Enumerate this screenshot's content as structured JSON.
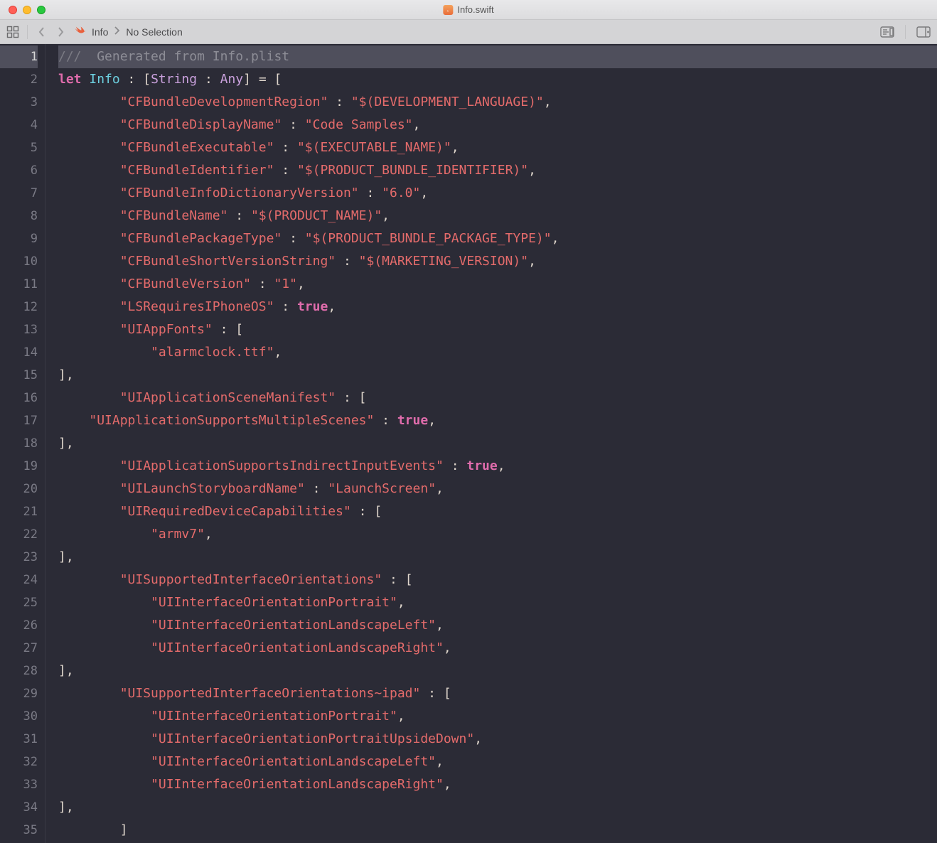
{
  "window": {
    "title": "Info.swift"
  },
  "jumpbar": {
    "file_crumb": "Info",
    "selection_crumb": "No Selection"
  },
  "editor": {
    "highlighted_line": 1,
    "lines_total": 35,
    "comment_slashes": "///",
    "comment_text": "Generated from Info.plist",
    "decl": {
      "let": "let",
      "name": "Info",
      "colon1": " : ",
      "lbracket_type": "[",
      "type_key": "String",
      "type_sep": " : ",
      "type_val": "Any",
      "rbracket_type": "]",
      "eq": " = ",
      "open": "["
    },
    "entries": [
      {
        "key": "\"CFBundleDevelopmentRegion\"",
        "sep": " : ",
        "val": "\"$(DEVELOPMENT_LANGUAGE)\"",
        "trail": ","
      },
      {
        "key": "\"CFBundleDisplayName\"",
        "sep": " : ",
        "val": "\"Code Samples\"",
        "trail": ","
      },
      {
        "key": "\"CFBundleExecutable\"",
        "sep": " : ",
        "val": "\"$(EXECUTABLE_NAME)\"",
        "trail": ","
      },
      {
        "key": "\"CFBundleIdentifier\"",
        "sep": " : ",
        "val": "\"$(PRODUCT_BUNDLE_IDENTIFIER)\"",
        "trail": ","
      },
      {
        "key": "\"CFBundleInfoDictionaryVersion\"",
        "sep": " : ",
        "val": "\"6.0\"",
        "trail": ","
      },
      {
        "key": "\"CFBundleName\"",
        "sep": " : ",
        "val": "\"$(PRODUCT_NAME)\"",
        "trail": ","
      },
      {
        "key": "\"CFBundlePackageType\"",
        "sep": " : ",
        "val": "\"$(PRODUCT_BUNDLE_PACKAGE_TYPE)\"",
        "trail": ","
      },
      {
        "key": "\"CFBundleShortVersionString\"",
        "sep": " : ",
        "val": "\"$(MARKETING_VERSION)\"",
        "trail": ","
      },
      {
        "key": "\"CFBundleVersion\"",
        "sep": " : ",
        "val": "\"1\"",
        "trail": ","
      }
    ],
    "ls_requires": {
      "key": "\"LSRequiresIPhoneOS\"",
      "sep": " : ",
      "bool": "true",
      "trail": ","
    },
    "uiappfonts": {
      "key": "\"UIAppFonts\"",
      "sep": " : ",
      "open": "[",
      "item": "\"alarmclock.ttf\"",
      "item_trail": ",",
      "close": "],"
    },
    "scene_manifest": {
      "key": "\"UIApplicationSceneManifest\"",
      "sep": " : ",
      "open": "["
    },
    "supports_multi": {
      "key": "\"UIApplicationSupportsMultipleScenes\"",
      "sep": " : ",
      "bool": "true",
      "trail": ",",
      "close": "],"
    },
    "supports_indirect": {
      "key": "\"UIApplicationSupportsIndirectInputEvents\"",
      "sep": " : ",
      "bool": "true",
      "trail": ","
    },
    "launch_sb": {
      "key": "\"UILaunchStoryboardName\"",
      "sep": " : ",
      "val": "\"LaunchScreen\"",
      "trail": ","
    },
    "req_caps": {
      "key": "\"UIRequiredDeviceCapabilities\"",
      "sep": " : ",
      "open": "[",
      "item": "\"armv7\"",
      "item_trail": ",",
      "close": "],"
    },
    "orient": {
      "key": "\"UISupportedInterfaceOrientations\"",
      "sep": " : ",
      "open": "[",
      "items": [
        "\"UIInterfaceOrientationPortrait\"",
        "\"UIInterfaceOrientationLandscapeLeft\"",
        "\"UIInterfaceOrientationLandscapeRight\""
      ],
      "item_trail": ",",
      "close": "],"
    },
    "orient_ipad": {
      "key": "\"UISupportedInterfaceOrientations~ipad\"",
      "sep": " : ",
      "open": "[",
      "items": [
        "\"UIInterfaceOrientationPortrait\"",
        "\"UIInterfaceOrientationPortraitUpsideDown\"",
        "\"UIInterfaceOrientationLandscapeLeft\"",
        "\"UIInterfaceOrientationLandscapeRight\""
      ],
      "item_trail": ",",
      "close": "],"
    },
    "final_close": "]"
  }
}
